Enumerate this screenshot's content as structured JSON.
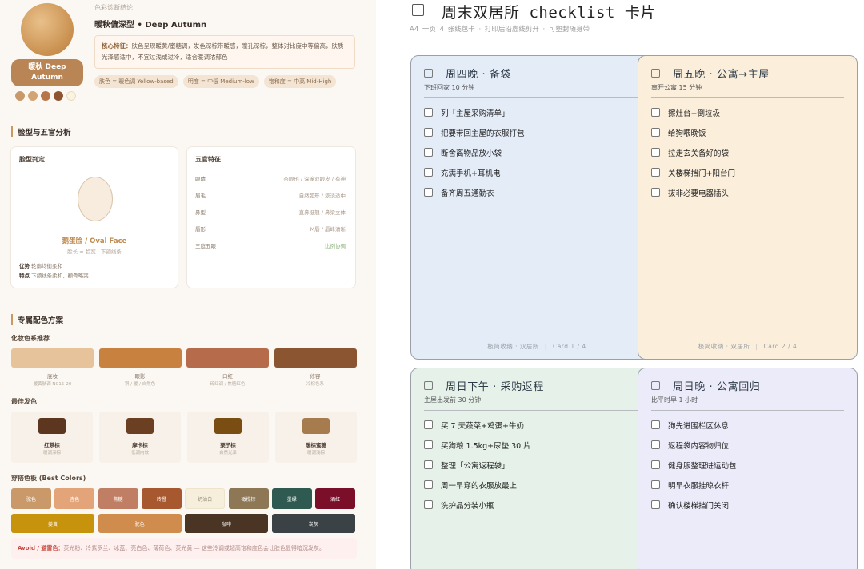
{
  "left": {
    "badge": "暖秋 Deep Autumn",
    "dots": [
      "#c89a6b",
      "#d2a474",
      "#b7764a",
      "#8f5530",
      "#fbf3df"
    ],
    "kicker": "色彩诊断结论",
    "title": "暖秋偏深型 • Deep Autumn",
    "trait_label": "核心特征：",
    "trait_text": "肤色呈现暖黄/蜜糖调，发色深棕带暖感，瞳孔深棕，整体对比度中等偏高，肤质光泽感适中，不宜过浅或过冷，适合暖调浓郁色",
    "chips": [
      "肤色 = 暖色调 Yellow-based",
      "明度 = 中低 Medium-low",
      "饱和度 = 中高 Mid-High"
    ],
    "face_section": "脸型与五官分析",
    "face_card_title": "脸型判定",
    "face_label": "鹅蛋脸 / Oval Face",
    "face_sub": "脸长 ≈ 脸宽 · 下颌线条",
    "face_strength_label": "优势",
    "face_strength": "轮廓均衡柔和",
    "face_feature_label": "特点",
    "face_feature": "下颌线条柔和，颧骨略突",
    "feature_card_title": "五官特征",
    "features": [
      {
        "k": "眼睛",
        "v": "杏眼形 / 深邃双眼皮 / 有神"
      },
      {
        "k": "眉毛",
        "v": "自然弧形 / 浓淡适中"
      },
      {
        "k": "鼻型",
        "v": "直鼻挺翘 / 鼻梁立体"
      },
      {
        "k": "唇形",
        "v": "M唇 / 唇峰清晰"
      },
      {
        "k": "三庭五眼",
        "v": "比例协调"
      }
    ],
    "color_section": "专属配色方案",
    "makeup_title": "化妆色系推荐",
    "makeup": [
      {
        "color": "#e7c39b",
        "label": "底妆",
        "sub": "暖黄肤调 NC15-20"
      },
      {
        "color": "#c8813f",
        "label": "眼影",
        "sub": "铜 / 暖 / 自然色"
      },
      {
        "color": "#b66b4b",
        "label": "口红",
        "sub": "砖红调 / 焦糖红色"
      },
      {
        "color": "#8a5530",
        "label": "修容",
        "sub": "冷棕色系"
      }
    ],
    "hair_title": "最佳发色",
    "hair": [
      {
        "color": "#5d3620",
        "name": "红茶棕",
        "sub": "暖调深棕"
      },
      {
        "color": "#6b3f22",
        "name": "摩卡棕",
        "sub": "低调内敛"
      },
      {
        "color": "#7a4e12",
        "name": "栗子棕",
        "sub": "自然光泽"
      },
      {
        "color": "#a67b4e",
        "name": "暖棕蜜糖",
        "sub": "暖调浅棕"
      }
    ],
    "wear_title": "穿搭色板 (Best Colors)",
    "palette_row1": [
      {
        "color": "#c9996a",
        "name": "驼色"
      },
      {
        "color": "#e4a47a",
        "name": "杏色"
      },
      {
        "color": "#c07f64",
        "name": "焦糖"
      },
      {
        "color": "#a7582f",
        "name": "砖橙"
      },
      {
        "color": "#f6efdc",
        "name": "奶油白"
      },
      {
        "color": "#8d7755",
        "name": "橄榄棕"
      },
      {
        "color": "#2f5a51",
        "name": "墨绿"
      },
      {
        "color": "#7b0f2a",
        "name": "酒红"
      }
    ],
    "palette_row2": [
      {
        "color": "#c7920c",
        "name": "姜黄"
      },
      {
        "color": "#d08c4d",
        "name": "驼色"
      },
      {
        "color": "#4a3423",
        "name": "咖啡"
      },
      {
        "color": "#3b4245",
        "name": "炭灰"
      }
    ],
    "avoid_label": "Avoid / 避雷色：",
    "avoid_text": "荧光粉、冷紫罗兰、冰蓝、亮白色、薄荷色、荧光黄 — 这些冷调或超高饱和度色会让肤色显得暗沉发灰。"
  },
  "right": {
    "title": "周末双居所 checklist 卡片",
    "meta": "A4 一页 4 张线包卡  ·  打印后沿虚线剪开  ·  可塑封随身带",
    "cards": [
      {
        "title": "周四晚 · 备袋",
        "sub": "下班回家 10 分钟",
        "bg": "#e4ecf8",
        "items": [
          "列「主屋采购清单」",
          "把要带回主屋的衣服打包",
          "断舍离物品放小袋",
          "充满手机+耳机电",
          "备齐周五通勤衣"
        ],
        "foot_left": "极简收纳 · 双居所",
        "foot_right": "Card 1 / 4"
      },
      {
        "title": "周五晚 · 公寓→主屋",
        "sub": "离开公寓 15 分钟",
        "bg": "#fbefdc",
        "items": [
          "擦灶台+倒垃圾",
          "给狗喂晚饭",
          "拉走玄关备好的袋",
          "关楼梯挡门+阳台门",
          "拔非必要电器插头"
        ],
        "foot_left": "极简收纳 · 双居所",
        "foot_right": "Card 2 / 4"
      },
      {
        "title": "周日下午 · 采购返程",
        "sub": "主屋出发前 30 分钟",
        "bg": "#e6f2e9",
        "items": [
          "买 7 天蔬菜+鸡蛋+牛奶",
          "买狗粮 1.5kg+尿垫 30 片",
          "整理「公寓返程袋」",
          "周一早穿的衣服放最上",
          "洗护品分装小瓶"
        ],
        "foot_left": "",
        "foot_right": ""
      },
      {
        "title": "周日晚 · 公寓回归",
        "sub": "比平时早 1 小时",
        "bg": "#ecebfa",
        "items": [
          "狗先进围栏区休息",
          "返程袋内容物归位",
          "健身服整理进运动包",
          "明早衣服挂晾衣杆",
          "确认楼梯挡门关闭"
        ],
        "foot_left": "",
        "foot_right": ""
      }
    ]
  }
}
